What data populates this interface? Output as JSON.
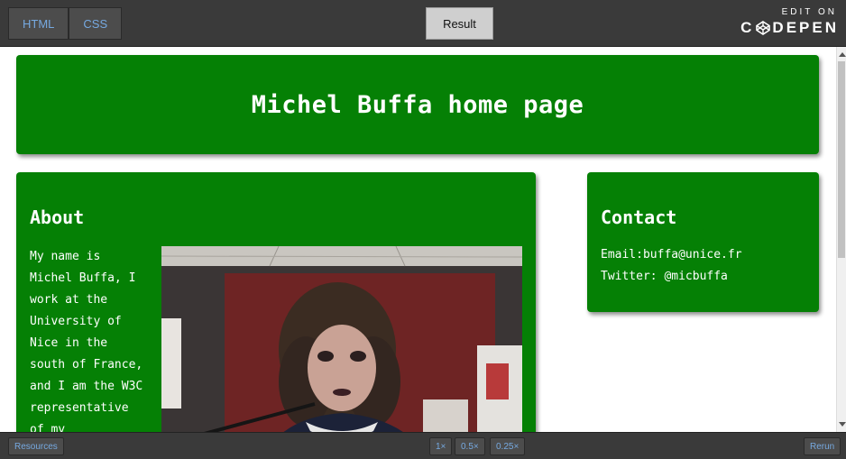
{
  "toolbar": {
    "html_tab": "HTML",
    "css_tab": "CSS",
    "result_tab": "Result",
    "edit_on": "EDIT ON",
    "brand": "C DEPEN"
  },
  "page": {
    "title": "Michel Buffa home page",
    "about": {
      "heading": "About",
      "text_lines": [
        "My name is",
        "Michel Buffa, I",
        "work at the",
        "University of",
        "Nice in the",
        "south of France,",
        "and I am the W3C",
        "representative",
        "of my"
      ]
    },
    "contact": {
      "heading": "Contact",
      "email": "Email:buffa@unice.fr",
      "twitter": "Twitter: @micbuffa"
    }
  },
  "footer": {
    "resources": "Resources",
    "zoom_1x": "1×",
    "zoom_05x": "0.5×",
    "zoom_025x": "0.25×",
    "rerun": "Rerun"
  },
  "colors": {
    "box_green": "#058005",
    "tab_text": "#76a9e0"
  }
}
